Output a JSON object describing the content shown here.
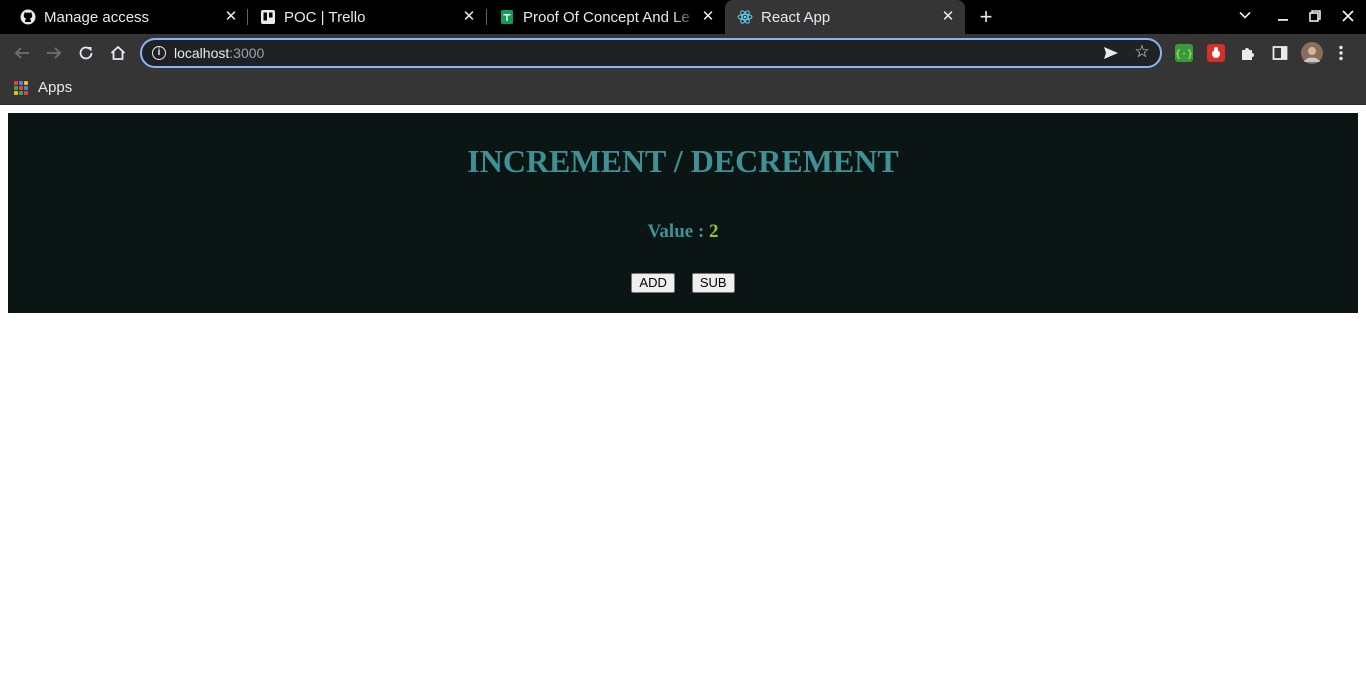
{
  "browser": {
    "tabs": [
      {
        "title": "Manage access",
        "favicon": "github-icon",
        "active": false
      },
      {
        "title": "POC | Trello",
        "favicon": "trello-icon",
        "active": false
      },
      {
        "title": "Proof Of Concept And Le",
        "favicon": "sheets-icon",
        "active": false
      },
      {
        "title": "React App",
        "favicon": "react-icon",
        "active": true
      }
    ],
    "address": {
      "host": "localhost",
      "port": ":3000"
    },
    "bookmarks": {
      "apps_label": "Apps"
    },
    "colors": {
      "tabbar": "#000000",
      "toolbar": "#353535",
      "focus_ring": "#8ab4f8"
    }
  },
  "app": {
    "heading": "INCREMENT / DECREMENT",
    "value_label": "Value : ",
    "value": "2",
    "add_label": "ADD",
    "sub_label": "SUB",
    "colors": {
      "panel_bg": "#0b1513",
      "heading": "#3f9196",
      "value": "#8fc43c"
    }
  }
}
